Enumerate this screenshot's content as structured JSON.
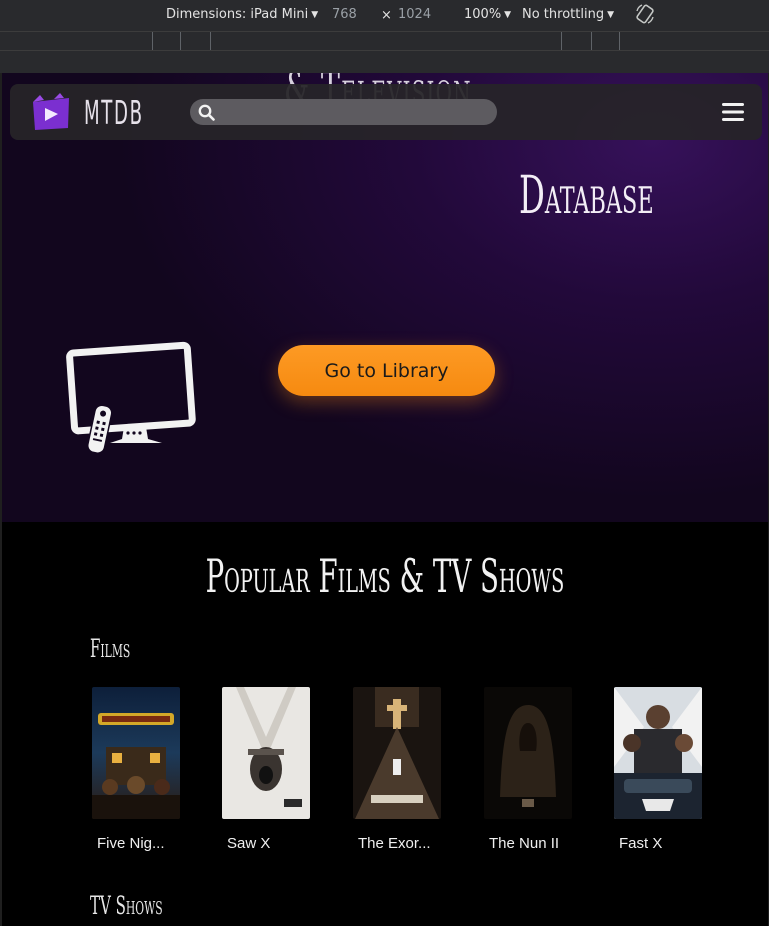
{
  "devtools": {
    "dimensions_label": "Dimensions: iPad Mini",
    "width": "768",
    "x": "×",
    "height": "1024",
    "zoom": "100%",
    "throttle": "No throttling"
  },
  "navbar": {
    "logo_text": "MTDB",
    "search_placeholder": ""
  },
  "hero": {
    "line1": "& Television",
    "line2": "Database",
    "button_label": "Go to Library"
  },
  "popular": {
    "title": "Popular Films & TV Shows",
    "films_label": "Films",
    "tv_label": "TV Shows",
    "films": [
      {
        "title": "Five Nig..."
      },
      {
        "title": "Saw X"
      },
      {
        "title": "The Exor..."
      },
      {
        "title": "The Nun II"
      },
      {
        "title": "Fast X"
      }
    ]
  },
  "colors": {
    "accent": "#f68a10",
    "brand_purple": "#7b2fd0",
    "hero_bg": "#22093a"
  }
}
